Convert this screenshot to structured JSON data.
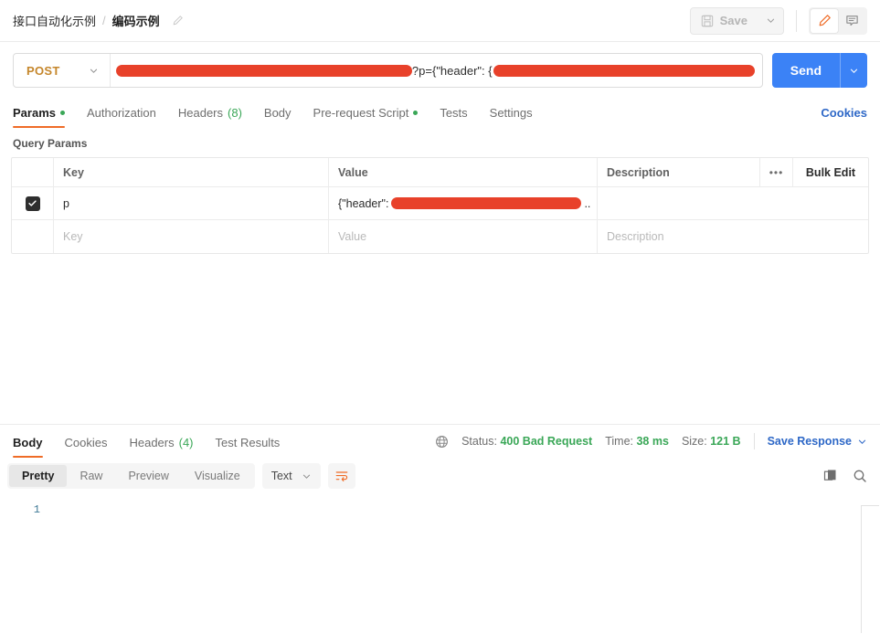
{
  "topbar": {
    "breadcrumb_parent": "接口自动化示例",
    "breadcrumb_sep": "/",
    "breadcrumb_current": "编码示例",
    "edit_icon": "pencil-icon",
    "save_label": "Save",
    "save_caret_icon": "chevron-down-icon",
    "pencil_icon": "pencil-icon",
    "comment_icon": "comment-icon"
  },
  "url_bar": {
    "method": "POST",
    "method_caret_icon": "chevron-down-icon",
    "url_prefix_redacted": true,
    "url_visible_text": "?p={\"header\": {",
    "url_suffix_redacted": true,
    "send_label": "Send",
    "send_caret_icon": "chevron-down-icon"
  },
  "request_tabs": {
    "items": [
      {
        "label": "Params",
        "active": true,
        "dot": true,
        "count": ""
      },
      {
        "label": "Authorization",
        "active": false,
        "dot": false,
        "count": ""
      },
      {
        "label": "Headers",
        "active": false,
        "dot": false,
        "count": "(8)"
      },
      {
        "label": "Body",
        "active": false,
        "dot": false,
        "count": ""
      },
      {
        "label": "Pre-request Script",
        "active": false,
        "dot": true,
        "count": ""
      },
      {
        "label": "Tests",
        "active": false,
        "dot": false,
        "count": ""
      },
      {
        "label": "Settings",
        "active": false,
        "dot": false,
        "count": ""
      }
    ],
    "cookies_label": "Cookies"
  },
  "query_params": {
    "section_title": "Query Params",
    "headers": {
      "key": "Key",
      "value": "Value",
      "description": "Description",
      "more_icon": "ellipsis-icon",
      "bulk_edit": "Bulk Edit"
    },
    "rows": [
      {
        "checked": true,
        "key": "p",
        "value_prefix": "{\"header\": ",
        "value_redacted": true,
        "value_suffix": "..",
        "description": ""
      }
    ],
    "empty_row_placeholders": {
      "key": "Key",
      "value": "Value",
      "description": "Description"
    }
  },
  "response": {
    "tabs": [
      {
        "label": "Body",
        "active": true,
        "count": ""
      },
      {
        "label": "Cookies",
        "active": false,
        "count": ""
      },
      {
        "label": "Headers",
        "active": false,
        "count": "(4)"
      },
      {
        "label": "Test Results",
        "active": false,
        "count": ""
      }
    ],
    "globe_icon": "globe-icon",
    "status_label": "Status:",
    "status_value": "400 Bad Request",
    "time_label": "Time:",
    "time_value": "38 ms",
    "size_label": "Size:",
    "size_value": "121 B",
    "save_response_label": "Save Response",
    "save_response_caret_icon": "chevron-down-icon",
    "view_modes": [
      {
        "label": "Pretty",
        "active": true
      },
      {
        "label": "Raw",
        "active": false
      },
      {
        "label": "Preview",
        "active": false
      },
      {
        "label": "Visualize",
        "active": false
      }
    ],
    "format_value": "Text",
    "format_caret_icon": "chevron-down-icon",
    "wrap_icon": "word-wrap-icon",
    "copy_icon": "copy-icon",
    "search_icon": "search-icon",
    "line_numbers": [
      "1"
    ],
    "body_text": ""
  },
  "colors": {
    "accent_orange": "#ef6c27",
    "send_blue": "#3b82f6",
    "link_blue": "#2e68c7",
    "status_green": "#3aa757",
    "method_amber": "#c5862b",
    "redaction_red": "#e8412a",
    "line_number_teal": "#3f7a96"
  }
}
